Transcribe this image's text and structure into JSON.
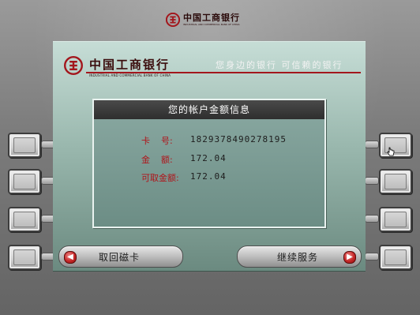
{
  "branding": {
    "top_logo_cn": "中国工商银行",
    "top_logo_en": "INDUSTRIAL AND COMMERCIAL BANK OF CHINA",
    "header_cn": "中国工商银行",
    "header_en": "INDUSTRIAL AND COMMERCIAL BANK OF CHINA",
    "slogan": "您身边的银行  可信赖的银行",
    "brand_color": "#a3171d"
  },
  "info": {
    "title": "您的帐户金额信息",
    "card_label": "卡    号:",
    "card_value": "1829378490278195",
    "balance_label": "金    额:",
    "balance_value": "172.04",
    "available_label": "可取金额:",
    "available_value": "172.04"
  },
  "actions": {
    "return_card": "取回磁卡",
    "continue": "继续服务",
    "return_icon": "arrow-left-icon",
    "continue_icon": "arrow-right-icon"
  },
  "colors": {
    "screen_bg": "#9ab8ae",
    "label_red": "#b0141a",
    "title_bar": "#2e2e2e"
  }
}
